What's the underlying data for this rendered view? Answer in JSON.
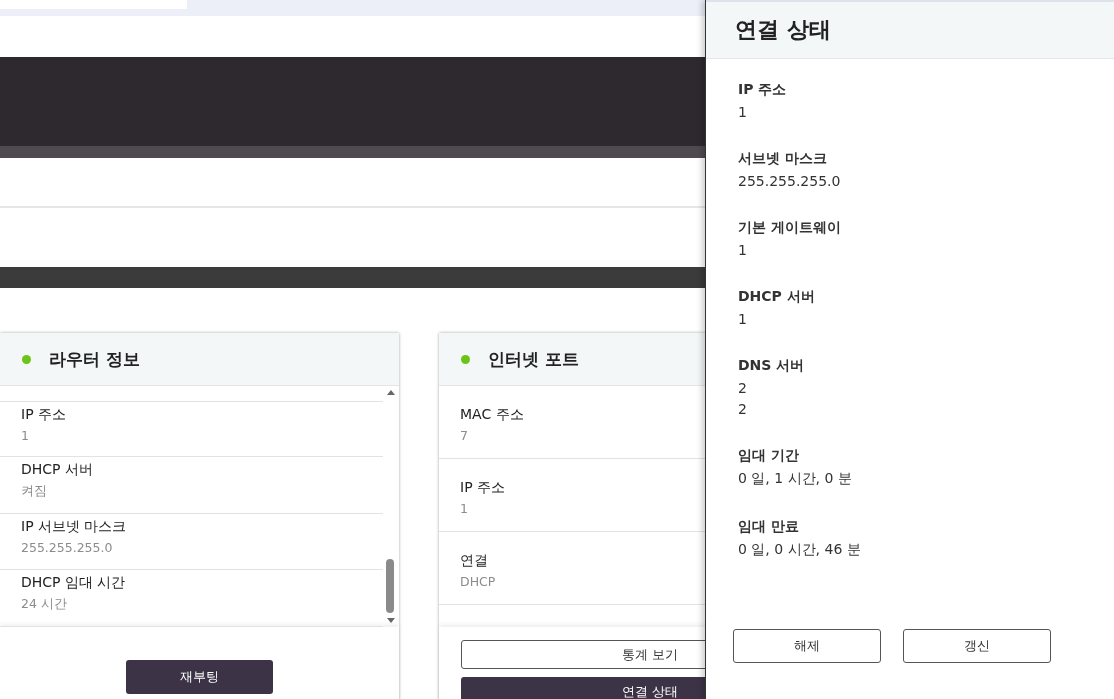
{
  "cards": [
    {
      "title": "라우터 정보",
      "color": "#6cc417",
      "rows": [
        {
          "label": "IP 주소",
          "value": "1"
        },
        {
          "label": "DHCP 서버",
          "value": "켜짐"
        },
        {
          "label": "IP 서브넷 마스크",
          "value": "255.255.255.0"
        },
        {
          "label": "DHCP 임대 시간",
          "value": "24 시간"
        }
      ],
      "buttons": [
        {
          "label": "재부팅",
          "kind": "primary"
        }
      ]
    },
    {
      "title": "인터넷 포트",
      "color": "#6cc417",
      "rows": [
        {
          "label": "MAC 주소",
          "value": "7"
        },
        {
          "label": "IP 주소",
          "value": "1"
        },
        {
          "label": "연결",
          "value": "DHCP"
        }
      ],
      "buttons": [
        {
          "label": "통계 보기",
          "kind": "outline"
        },
        {
          "label": "연결 상태",
          "kind": "primary"
        }
      ]
    }
  ],
  "drawer": {
    "title": "연결 상태",
    "fields": [
      {
        "label": "IP 주소",
        "values": [
          "1"
        ]
      },
      {
        "label": "서브넷 마스크",
        "values": [
          "255.255.255.0"
        ]
      },
      {
        "label": "기본 게이트웨이",
        "values": [
          "1"
        ]
      },
      {
        "label": "DHCP 서버",
        "values": [
          "1"
        ]
      },
      {
        "label": "DNS 서버",
        "values": [
          "2",
          "2"
        ]
      },
      {
        "label": "임대 기간",
        "values": [
          "0 일, 1 시간, 0 분"
        ]
      },
      {
        "label": "임대 만료",
        "values": [
          "0 일, 0 시간, 46 분"
        ]
      }
    ],
    "buttons": [
      "해제",
      "갱신"
    ]
  }
}
